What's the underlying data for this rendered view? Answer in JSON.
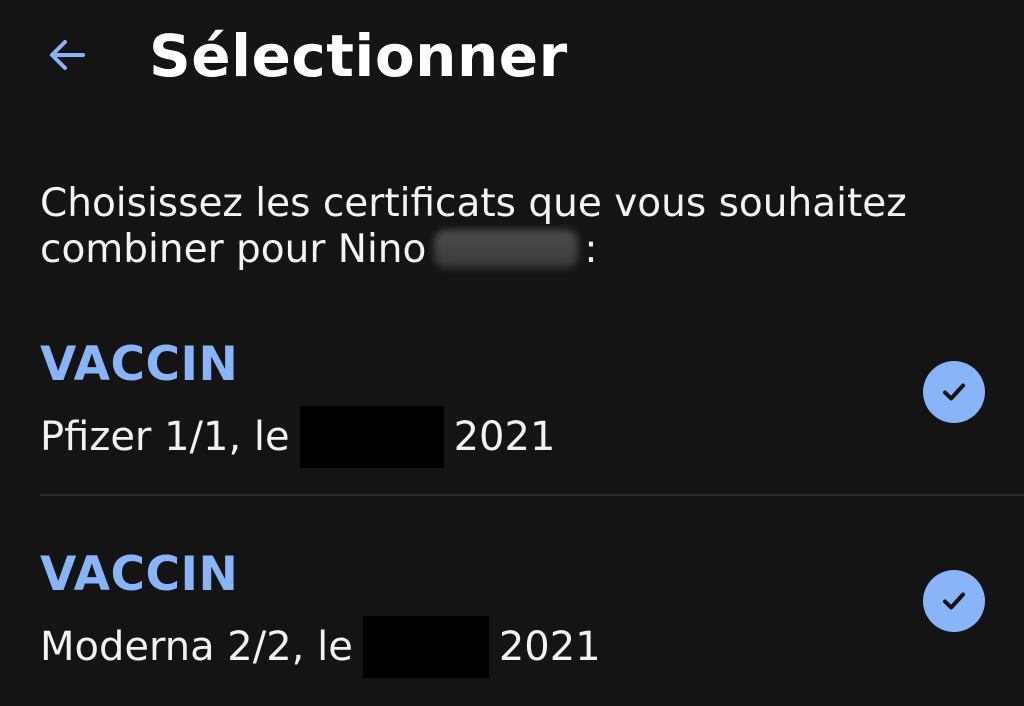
{
  "header": {
    "back_icon": "arrow-left-icon",
    "title": "Sélectionner"
  },
  "instruction": {
    "line1": "Choisissez les certificats que vous souhaitez",
    "line2_prefix": "combiner pour Nino",
    "line2_suffix": ":"
  },
  "certificates": [
    {
      "type": "VACCIN",
      "detail_prefix": "Pfizer 1/1, le",
      "detail_suffix": "2021",
      "selected_icon": "check-circle-icon"
    },
    {
      "type": "VACCIN",
      "detail_prefix": "Moderna 2/2, le",
      "detail_suffix": "2021",
      "selected_icon": "check-circle-icon"
    }
  ],
  "colors": {
    "background": "#141414",
    "accent": "#8ab4f8",
    "text": "#f2f2f2",
    "divider": "#2d2d2d",
    "redaction": "#000000"
  }
}
